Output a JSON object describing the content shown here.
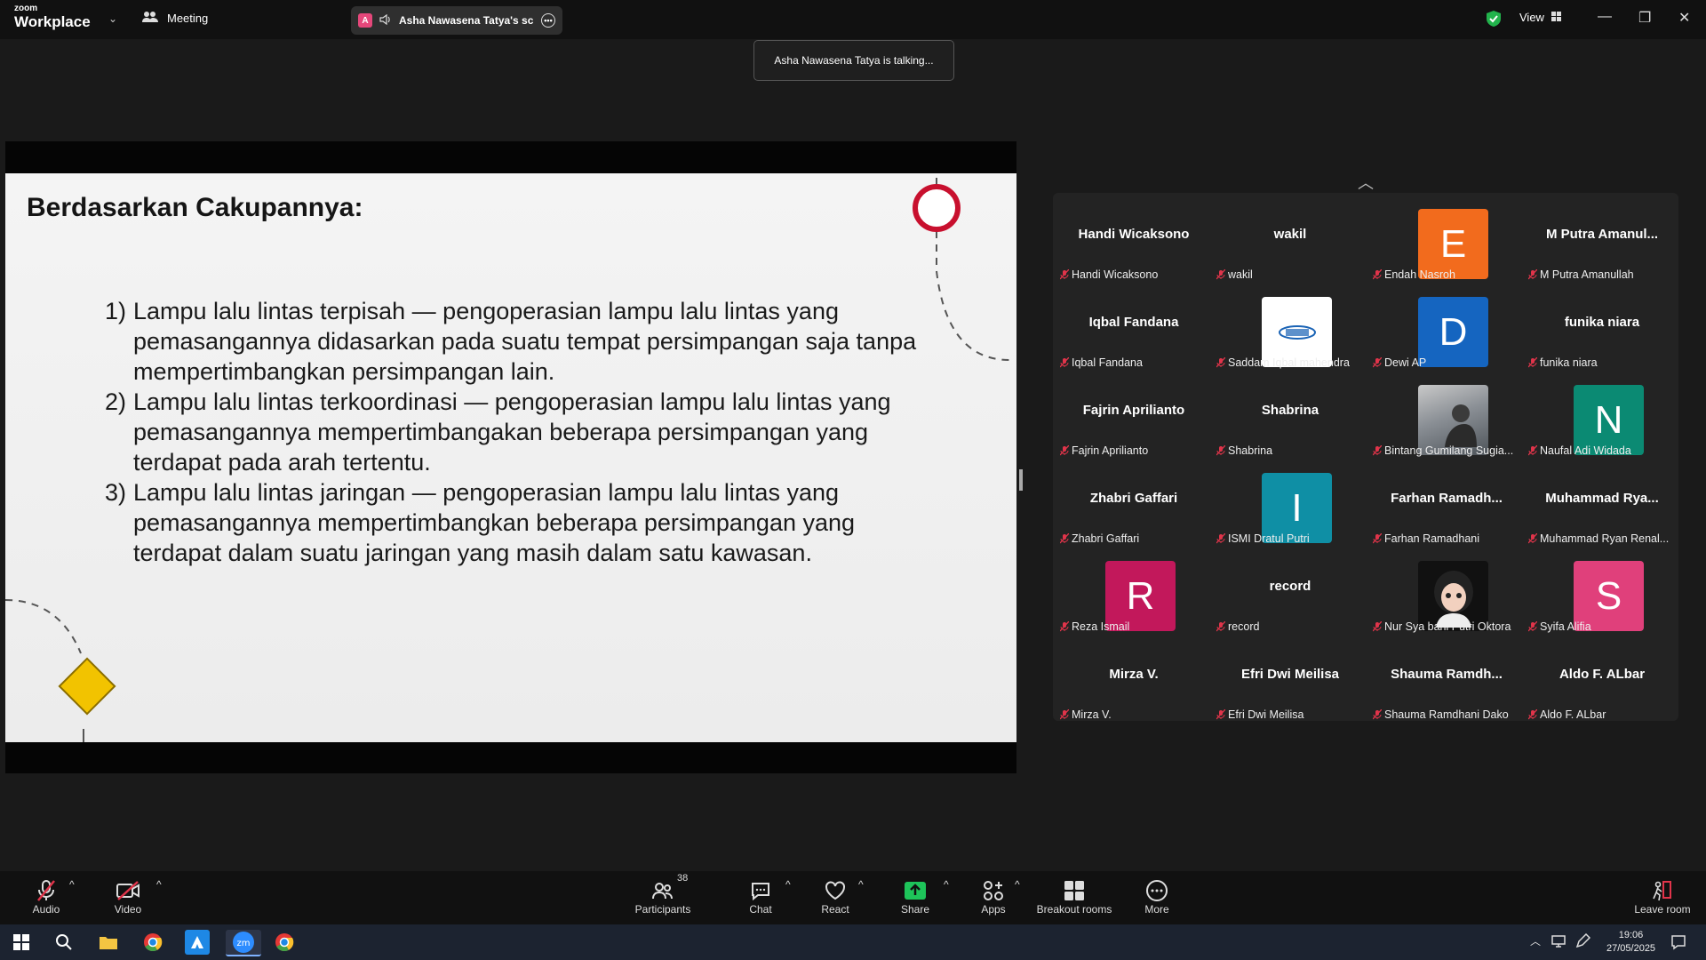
{
  "titlebar": {
    "brand_top": "zoom",
    "brand_main": "Workplace",
    "meeting_label": "Meeting",
    "share_tab_label": "Asha Nawasena Tatya's scree",
    "share_avatar_letter": "A",
    "view_label": "View"
  },
  "toast": "Asha Nawasena Tatya is talking...",
  "slide": {
    "title": "Berdasarkan Cakupannya:",
    "items": [
      {
        "num": "1)",
        "text": "Lampu lalu lintas terpisah — pengoperasian lampu lalu lintas yang pemasangannya didasarkan pada suatu tempat persimpangan saja tanpa mempertimbangkan persimpangan lain."
      },
      {
        "num": "2)",
        "text": "Lampu lalu lintas terkoordinasi — pengoperasian lampu lalu lintas yang pemasangannya mempertimbangakan beberapa persimpangan yang terdapat pada arah tertentu."
      },
      {
        "num": "3)",
        "text": "Lampu lalu lintas jaringan — pengoperasian lampu lalu lintas yang pemasangannya mempertimbangkan beberapa persimpangan yang terdapat dalam suatu jaringan yang masih dalam satu kawasan."
      }
    ]
  },
  "gallery": [
    [
      {
        "big": "Handi Wicaksono",
        "label": "Handi Wicaksono"
      },
      {
        "big": "wakil",
        "label": "wakil"
      },
      {
        "avatar": "E",
        "color": "#f26b1d",
        "label": "Endah Nasroh"
      },
      {
        "big": "M Putra Amanul...",
        "label": "M Putra Amanullah"
      }
    ],
    [
      {
        "big": "Iqbal Fandana",
        "label": "Iqbal Fandana"
      },
      {
        "avatar": "",
        "color": "#ffffff",
        "logo": true,
        "label": "Saddam Iqbal mahendra"
      },
      {
        "avatar": "D",
        "color": "#1565c0",
        "label": "Dewi AP"
      },
      {
        "big": "funika niara",
        "label": "funika niara"
      }
    ],
    [
      {
        "big": "Fajrin Aprilianto",
        "label": "Fajrin Aprilianto"
      },
      {
        "big": "Shabrina",
        "label": "Shabrina"
      },
      {
        "avatar": "",
        "color": "#7a8088",
        "photo": true,
        "label": "Bintang Gumilang Sugia..."
      },
      {
        "avatar": "N",
        "color": "#0b8a73",
        "label": "Naufal Adi Widada"
      }
    ],
    [
      {
        "big": "Zhabri Gaffari",
        "label": "Zhabri Gaffari"
      },
      {
        "avatar": "I",
        "color": "#0f8fa5",
        "label": "ISMI Dratul Putri"
      },
      {
        "big": "Farhan Ramadh...",
        "label": "Farhan Ramadhani"
      },
      {
        "big": "Muhammad Rya...",
        "label": "Muhammad Ryan Renal..."
      }
    ],
    [
      {
        "avatar": "R",
        "color": "#c2185b",
        "label": "Reza Ismail"
      },
      {
        "big": "record",
        "label": "record"
      },
      {
        "avatar": "",
        "color": "#111111",
        "photo2": true,
        "label": "Nur Sya bani Putri Oktora"
      },
      {
        "avatar": "S",
        "color": "#e0407b",
        "label": "Syifa Alifia"
      }
    ],
    [
      {
        "big": "Mirza V.",
        "label": "Mirza V."
      },
      {
        "big": "Efri Dwi Meilisa",
        "label": "Efri Dwi Meilisa"
      },
      {
        "big": "Shauma Ramdh...",
        "label": "Shauma Ramdhani Dako"
      },
      {
        "big": "Aldo F. ALbar",
        "label": "Aldo F. ALbar"
      }
    ]
  ],
  "toolbar": {
    "audio": "Audio",
    "video": "Video",
    "participants": "Participants",
    "participants_count": "38",
    "chat": "Chat",
    "react": "React",
    "share": "Share",
    "apps": "Apps",
    "breakout": "Breakout rooms",
    "more": "More",
    "leave": "Leave room"
  },
  "taskbar": {
    "time": "19:06",
    "date": "27/05/2025"
  },
  "colors": {
    "share_green": "#1ec45a",
    "mute_red": "#e0344a",
    "shield_green": "#22b34c"
  }
}
